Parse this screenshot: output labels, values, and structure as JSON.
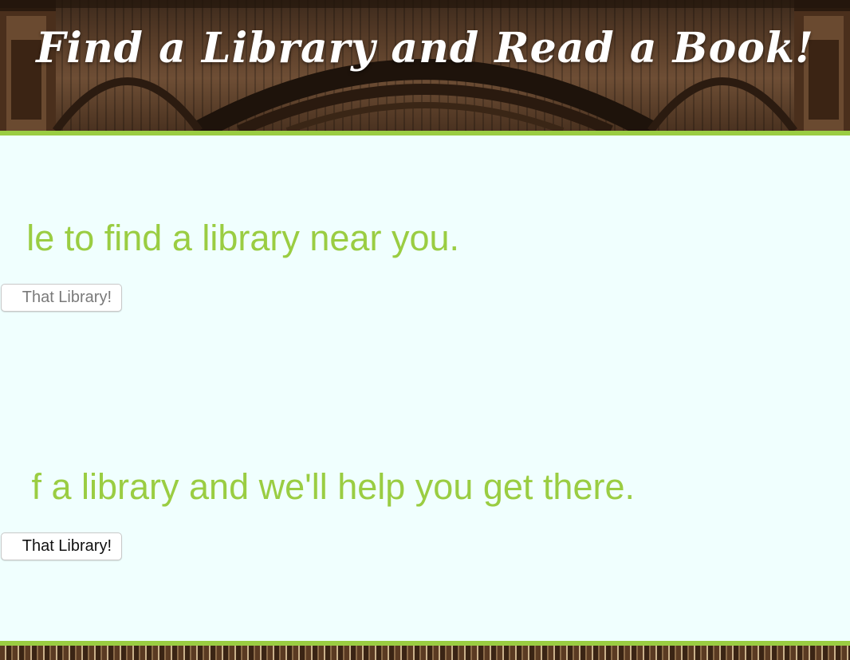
{
  "header": {
    "title": "Find a Library and Read a Book!"
  },
  "sections": [
    {
      "prompt": "le to find a library near you.",
      "button_label": "That Library!"
    },
    {
      "prompt": "f a library and we'll help you get there.",
      "button_label": "That Library!"
    }
  ],
  "colors": {
    "accent": "#9acd42",
    "panel_background": "#f0fffe",
    "title_text": "#ffffff"
  }
}
